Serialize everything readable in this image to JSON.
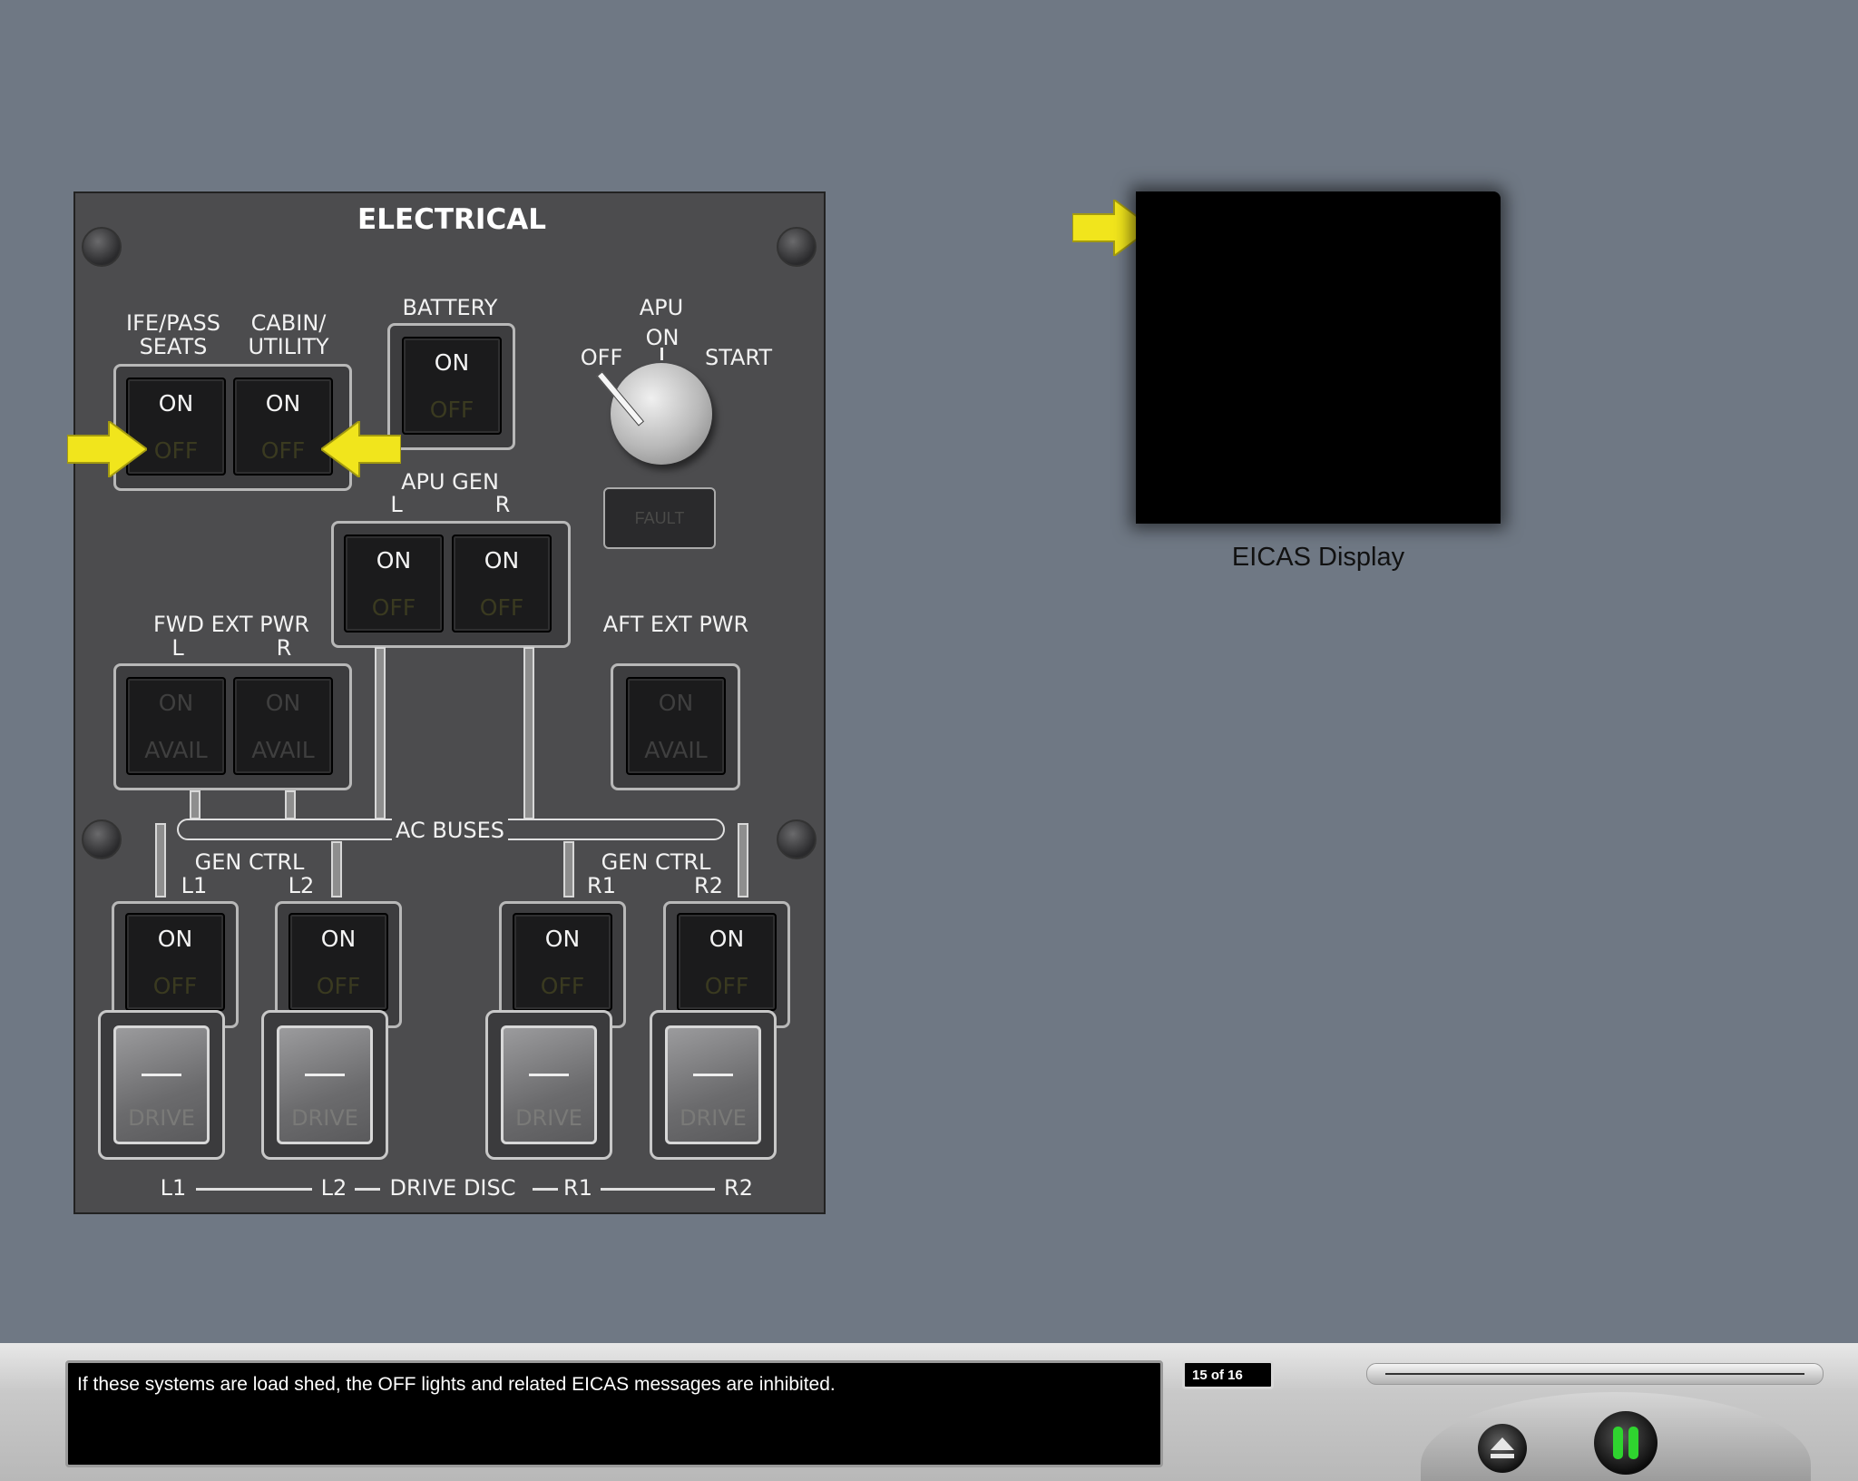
{
  "panel": {
    "title": "ELECTRICAL",
    "ife": {
      "line1": "IFE/PASS",
      "line2": "SEATS",
      "on": "ON",
      "off": "OFF"
    },
    "cabin": {
      "line1": "CABIN/",
      "line2": "UTILITY",
      "on": "ON",
      "off": "OFF"
    },
    "battery": {
      "label": "BATTERY",
      "on": "ON",
      "off": "OFF"
    },
    "apu": {
      "label": "APU",
      "off": "OFF",
      "on": "ON",
      "start": "START",
      "fault": "FAULT"
    },
    "apu_gen": {
      "label": "APU GEN",
      "l": "L",
      "r": "R",
      "on": "ON",
      "off": "OFF"
    },
    "fwd_ext": {
      "label": "FWD EXT PWR",
      "l": "L",
      "r": "R",
      "on": "ON",
      "avail": "AVAIL"
    },
    "aft_ext": {
      "label": "AFT EXT PWR",
      "on": "ON",
      "avail": "AVAIL"
    },
    "ac_buses": "AC BUSES",
    "gen_ctrl_left": {
      "label": "GEN CTRL",
      "l1": "L1",
      "l2": "L2"
    },
    "gen_ctrl_right": {
      "label": "GEN CTRL",
      "r1": "R1",
      "r2": "R2"
    },
    "gen_switches": [
      {
        "on": "ON",
        "off": "OFF",
        "drive": "DRIVE"
      },
      {
        "on": "ON",
        "off": "OFF",
        "drive": "DRIVE"
      },
      {
        "on": "ON",
        "off": "OFF",
        "drive": "DRIVE"
      },
      {
        "on": "ON",
        "off": "OFF",
        "drive": "DRIVE"
      }
    ],
    "drive_disc": {
      "l1": "L1",
      "l2": "L2",
      "label": "DRIVE DISC",
      "r1": "R1",
      "r2": "R2"
    }
  },
  "eicas": {
    "label": "EICAS Display"
  },
  "footer": {
    "caption": "If these systems are load shed, the OFF lights and related EICAS messages are inhibited.",
    "page": "15 of 16"
  },
  "colors": {
    "arrow": "#f1e51c",
    "background": "#6f7884",
    "panel": "#4c4c4e"
  },
  "icons": {
    "eject": "eject-icon",
    "pause": "pause-icon",
    "arrow": "arrow-pointer-icon"
  }
}
